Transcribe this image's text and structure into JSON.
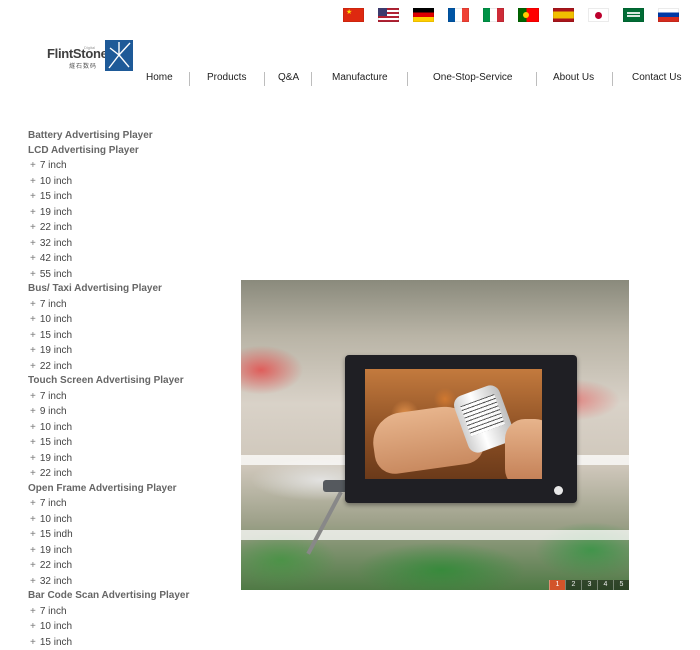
{
  "logo": {
    "text": "FlintStone",
    "subtitle": "燧石数码",
    "tag": "Digital"
  },
  "flags": [
    "china-flag-icon",
    "usa-flag-icon",
    "germany-flag-icon",
    "france-flag-icon",
    "italy-flag-icon",
    "portugal-flag-icon",
    "spain-flag-icon",
    "japan-flag-icon",
    "saudi-arabia-flag-icon",
    "russia-flag-icon"
  ],
  "nav": [
    "Home",
    "Products",
    "Q&A",
    "Manufacture",
    "One-Stop-Service",
    "About Us",
    "Contact Us"
  ],
  "sidebar": {
    "categories": [
      {
        "label": "Battery Advertising Player",
        "items": []
      },
      {
        "label": "LCD Advertising Player",
        "items": [
          "7 inch",
          "10 inch",
          "15 inch",
          "19 inch",
          "22 inch",
          "32 inch",
          "42 inch",
          "55 inch"
        ]
      },
      {
        "label": "Bus/ Taxi Advertising Player",
        "items": [
          "7 inch",
          "10 inch",
          "15 inch",
          "19 inch",
          "22 inch"
        ]
      },
      {
        "label": "Touch Screen Advertising Player",
        "items": [
          "7 inch",
          "9 inch",
          "10 inch",
          "15 inch",
          "19 inch",
          "22 inch"
        ]
      },
      {
        "label": "Open Frame Advertising Player",
        "items": [
          "7 inch",
          "10 inch",
          "15 indh",
          "19 inch",
          "22 inch",
          "32 inch"
        ]
      },
      {
        "label": "Bar Code Scan Advertising Player",
        "items": [
          "7 inch",
          "10 inch",
          "15 inch"
        ]
      }
    ],
    "plus": "+"
  },
  "banner": {
    "pages": [
      "1",
      "2",
      "3",
      "4",
      "5"
    ],
    "active_page": "1"
  }
}
